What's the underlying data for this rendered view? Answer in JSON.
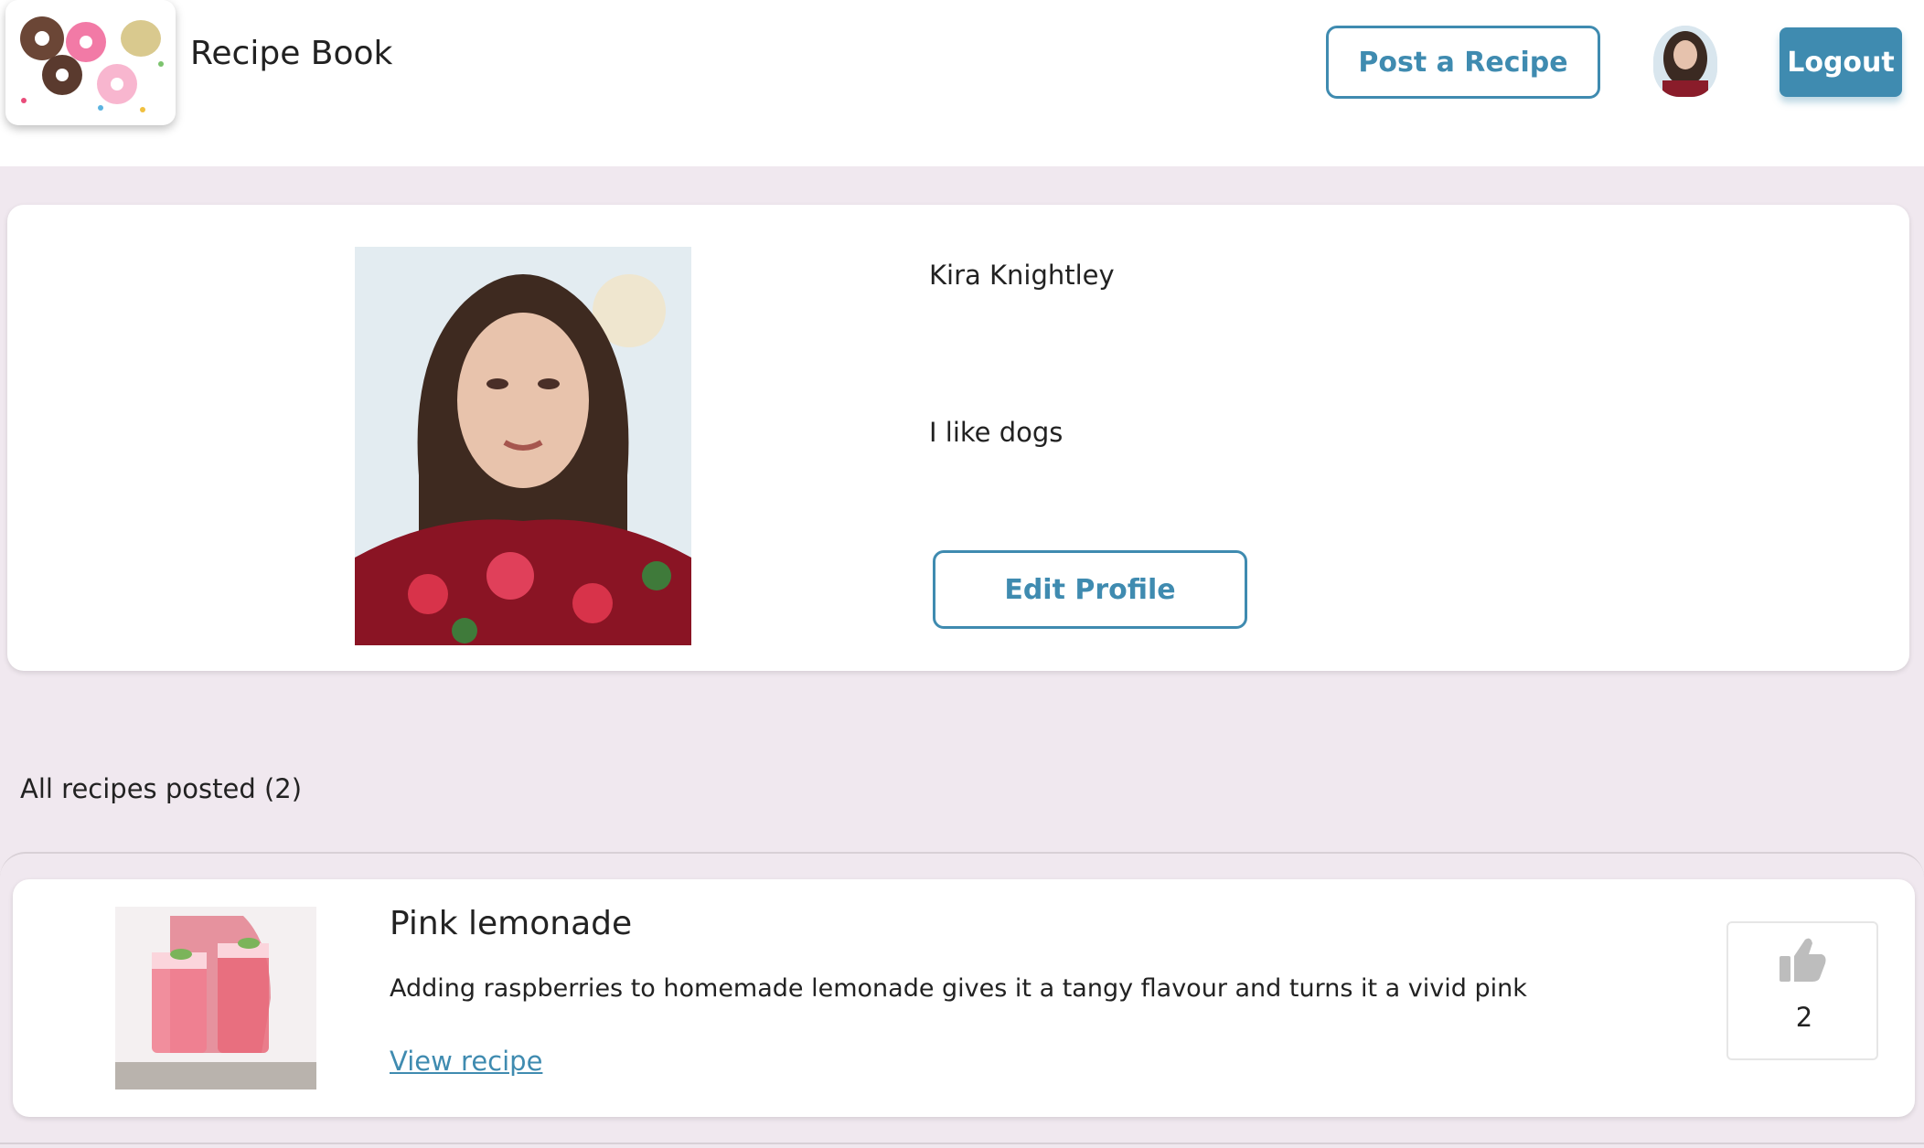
{
  "header": {
    "app_title": "Recipe Book",
    "post_label": "Post a Recipe",
    "logout_label": "Logout"
  },
  "profile": {
    "name": "Kira Knightley",
    "bio": "I like dogs",
    "edit_label": "Edit Profile"
  },
  "recipes_section": {
    "count_label": "All recipes posted (2)"
  },
  "recipes": [
    {
      "title": "Pink lemonade",
      "description": "Adding raspberries to homemade lemonade gives it a tangy flavour and turns it a vivid pink",
      "link_label": "View recipe",
      "likes": "2"
    }
  ],
  "icons": {
    "thumbs_up": "thumbs-up-icon"
  },
  "colors": {
    "accent": "#3f8bb0",
    "page_bg": "#f0e8ef"
  }
}
